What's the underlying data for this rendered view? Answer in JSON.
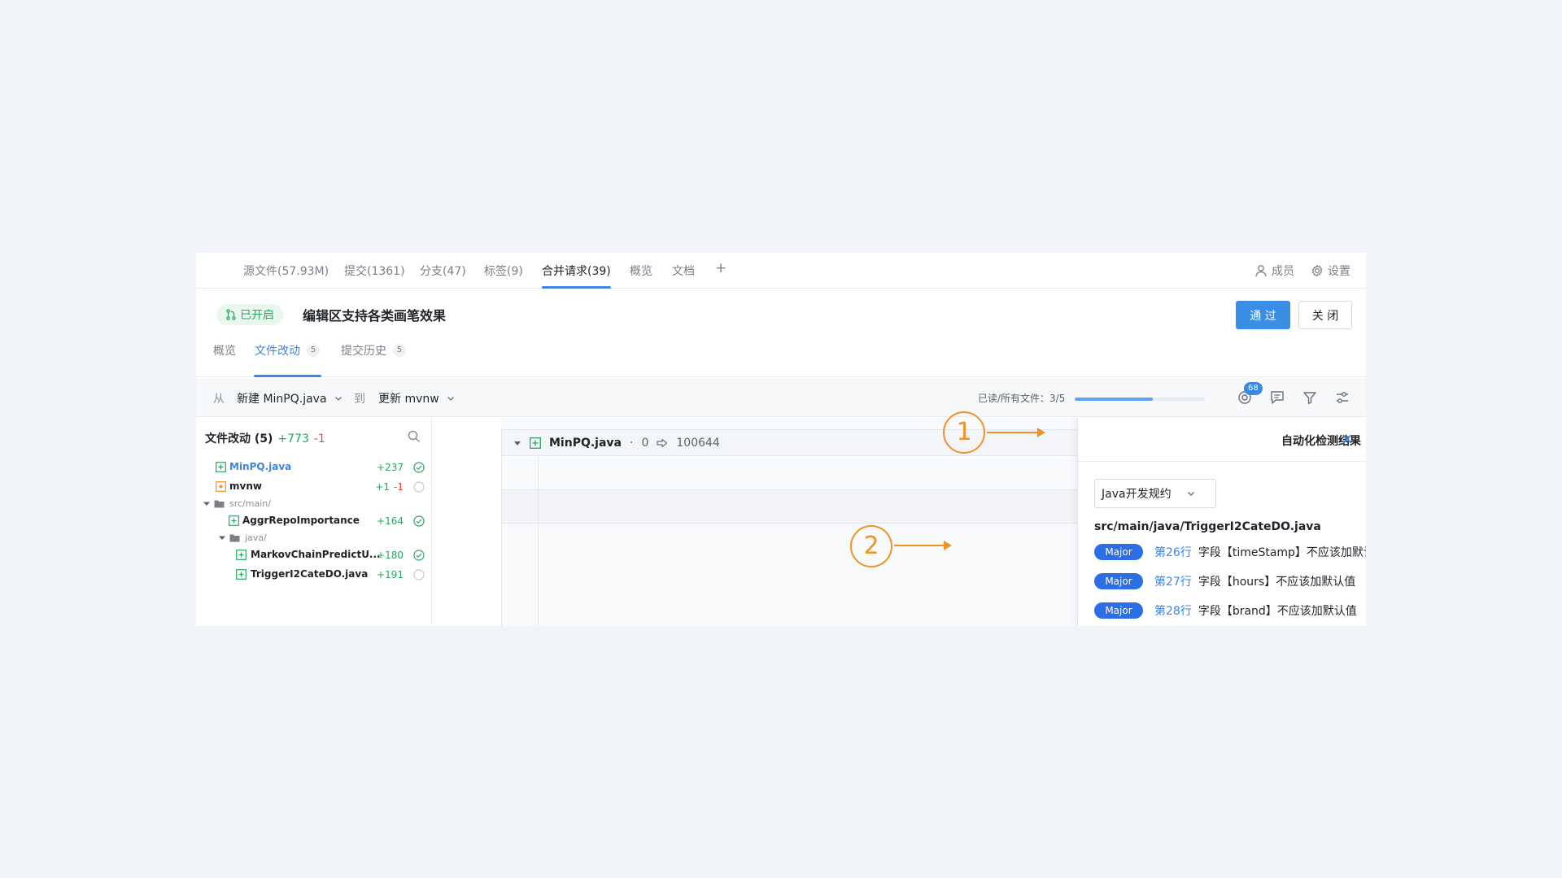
{
  "topnav": {
    "tabs": [
      {
        "label": "源文件(57.93M)"
      },
      {
        "label": "提交(1361)"
      },
      {
        "label": "分支(47)"
      },
      {
        "label": "标签(9)"
      },
      {
        "label": "合并请求(39)"
      },
      {
        "label": "概览"
      },
      {
        "label": "文档"
      }
    ],
    "add_label": "+",
    "members_label": "成员",
    "settings_label": "设置"
  },
  "header": {
    "status": "已开启",
    "title": "编辑区支持各类画笔效果",
    "approve_label": "通 过",
    "close_label": "关 闭"
  },
  "subtabs": {
    "overview": "概览",
    "changes": "文件改动",
    "changes_count": "5",
    "history": "提交历史",
    "history_count": "5"
  },
  "branchbar": {
    "from_label": "从",
    "from_value": "新建 MinPQ.java",
    "to_label": "到",
    "to_value": "更新 mvnw",
    "progress_label": "已读/所有文件：3/5",
    "progress_fraction": 0.6,
    "notif_count": "68"
  },
  "filepanel": {
    "title": "文件改动 (5)",
    "added": "+773",
    "deleted": "-1",
    "files": [
      {
        "name": "MinPQ.java",
        "add": "+237",
        "del": "",
        "checked": true,
        "kind": "file"
      },
      {
        "name": "mvnw",
        "add": "+1",
        "del": "-1",
        "checked": false,
        "kind": "modified"
      },
      {
        "name": "src/main/",
        "kind": "dir"
      },
      {
        "name": "AggrRepoImportance",
        "add": "+164",
        "del": "",
        "checked": true,
        "kind": "file"
      },
      {
        "name": "java/",
        "kind": "dir"
      },
      {
        "name": "MarkovChainPredictU...",
        "add": "+180",
        "del": "",
        "checked": true,
        "kind": "file"
      },
      {
        "name": "TriggerI2CateDO.java",
        "add": "+191",
        "del": "",
        "checked": false,
        "kind": "file"
      }
    ]
  },
  "code": {
    "filename": "MinPQ.java",
    "sep": "·",
    "old_mode": "0",
    "new_mode": "100644"
  },
  "results": {
    "title": "自动化检测结果",
    "ruleset": "Java开发规约",
    "path": "src/main/java/TriggerI2CateDO.java",
    "issues": [
      {
        "severity": "Major",
        "line": "第26行",
        "message": "字段【timeStamp】不应该加默认值"
      },
      {
        "severity": "Major",
        "line": "第27行",
        "message": "字段【hours】不应该加默认值"
      },
      {
        "severity": "Major",
        "line": "第28行",
        "message": "字段【brand】不应该加默认值"
      }
    ]
  },
  "callouts": {
    "one": "1",
    "two": "2"
  },
  "colors": {
    "accent": "#3b86e6",
    "success": "#2aa562",
    "danger": "#e84848",
    "callout": "#f0912a"
  }
}
